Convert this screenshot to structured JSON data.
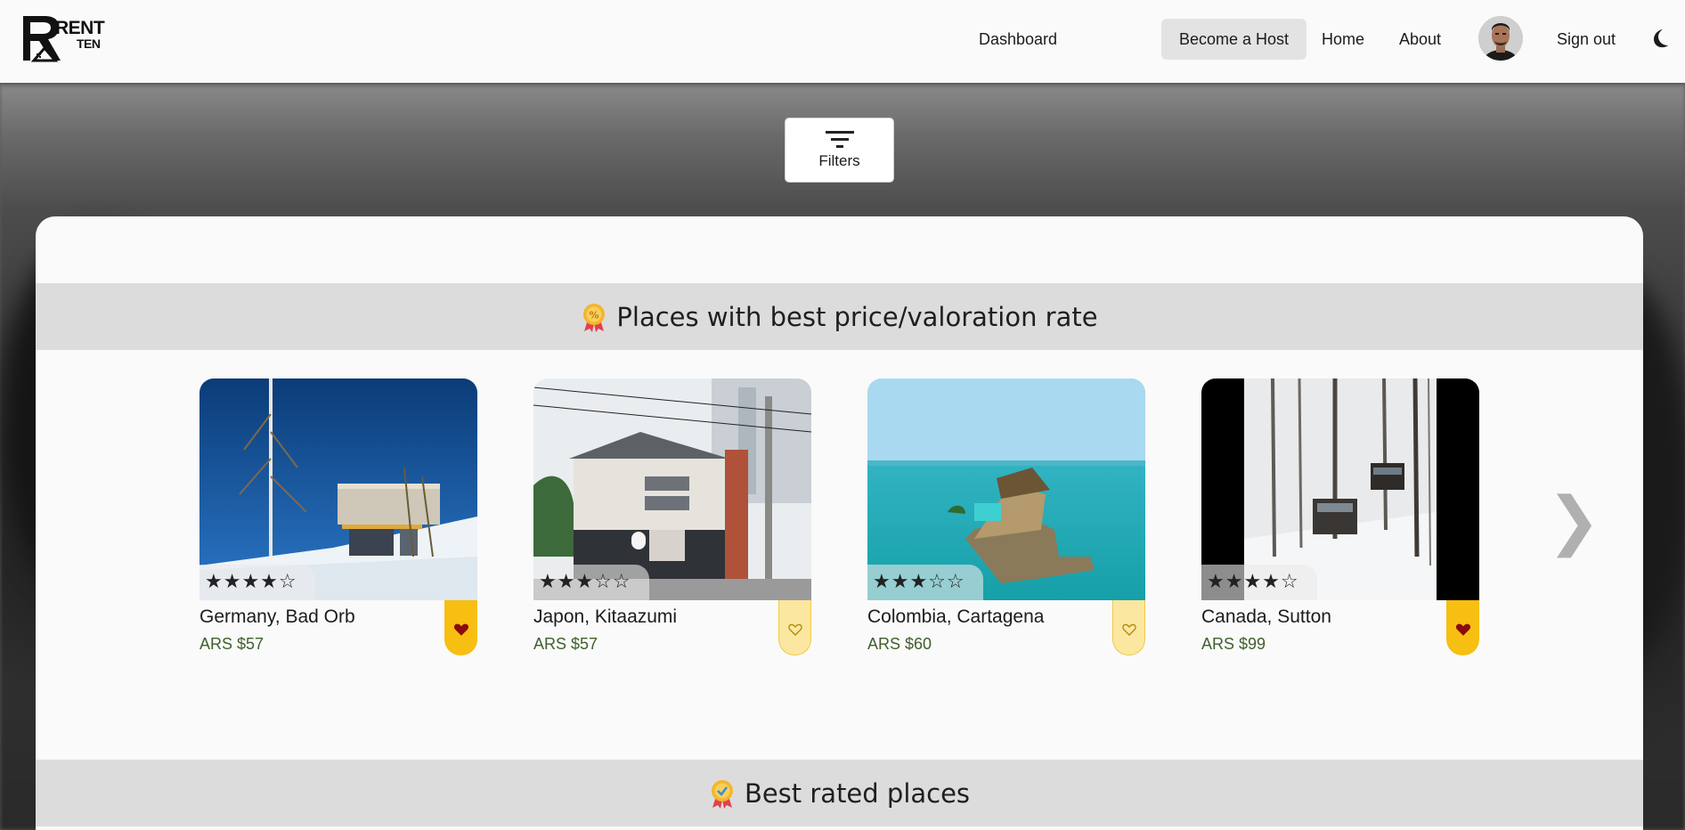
{
  "navbar": {
    "logo": {
      "line1": "RENT",
      "line2": "TEN"
    },
    "links": {
      "dashboard": "Dashboard",
      "become_host": "Become a Host",
      "home": "Home",
      "about": "About",
      "sign_out": "Sign out"
    },
    "icons": {
      "avatar": "user-avatar",
      "theme": "moon-icon"
    }
  },
  "filters": {
    "label": "Filters",
    "icon": "filter-lines-icon"
  },
  "sections": [
    {
      "title": "Places with best price/valoration rate",
      "icon": "medal-percent-icon"
    },
    {
      "title": "Best rated places",
      "icon": "medal-check-icon"
    }
  ],
  "places": [
    {
      "title": "Germany, Bad Orb",
      "price": "ARS $57",
      "stars": "★★★★☆",
      "favorite": true
    },
    {
      "title": "Japon, Kitaazumi",
      "price": "ARS $57",
      "stars": "★★★☆☆",
      "favorite": false
    },
    {
      "title": "Colombia, Cartagena",
      "price": "ARS $60",
      "stars": "★★★☆☆",
      "favorite": false
    },
    {
      "title": "Canada, Sutton",
      "price": "ARS $99",
      "stars": "★★★★☆",
      "favorite": true
    }
  ],
  "carousel": {
    "next": "❯"
  },
  "colors": {
    "accent": "#f6bf12",
    "price": "#3f5f2c",
    "header_bg": "#dcdcdc"
  }
}
